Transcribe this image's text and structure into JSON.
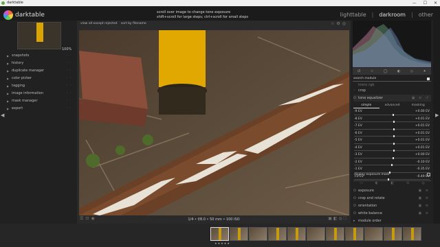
{
  "window": {
    "title": "darktable",
    "controls": [
      "—",
      "☐",
      "✕"
    ]
  },
  "app": {
    "brand": "darktable"
  },
  "hint": {
    "line1": "scroll over image to change tone exposure",
    "line2": "shift+scroll for large steps; ctrl+scroll for small steps"
  },
  "views": {
    "lighttable": "lighttable",
    "darkroom": "darkroom",
    "other": "other",
    "sep": "|"
  },
  "left_panel": {
    "zoom": "100%",
    "modules": [
      "snapshots",
      "history",
      "duplicate manager",
      "color picker",
      "tagging",
      "image information",
      "mask manager",
      "export"
    ]
  },
  "center": {
    "filter_label": "view",
    "filter_value": "all except rejected",
    "sort_label": "sort by",
    "sort_value": "filename",
    "image_info": "1/4 • f/8.0 • 50 mm • 100 ISO"
  },
  "right_panel": {
    "search_label": "search module",
    "modules_top": [
      {
        "name": "input color",
        "partial": "lnmic rgb"
      },
      {
        "name": "crop"
      },
      {
        "name": "tone equalizer"
      }
    ],
    "tone_tabs": [
      "simple",
      "advanced",
      "masking"
    ],
    "active_tab": "simple",
    "ev_rows": [
      {
        "label": "-9 EV",
        "value": "+0.00 EV",
        "pos": 0.5
      },
      {
        "label": "-8 EV",
        "value": "+0.01 EV",
        "pos": 0.51
      },
      {
        "label": "-7 EV",
        "value": "+0.01 EV",
        "pos": 0.51
      },
      {
        "label": "-6 EV",
        "value": "+0.01 EV",
        "pos": 0.51
      },
      {
        "label": "-5 EV",
        "value": "+0.01 EV",
        "pos": 0.51
      },
      {
        "label": "-4 EV",
        "value": "+0.01 EV",
        "pos": 0.51
      },
      {
        "label": "-3 EV",
        "value": "+0.00 EV",
        "pos": 0.5
      },
      {
        "label": "-2 EV",
        "value": "-0.10 EV",
        "pos": 0.49
      },
      {
        "label": "-1 EV",
        "value": "-0.35 EV",
        "pos": 0.46
      },
      {
        "label": "+0 EV",
        "value": "-0.49 EV",
        "pos": 0.44
      }
    ],
    "display_mask": "display exposure mask",
    "modules_bottom": [
      "exposure",
      "crop and rotate",
      "orientation",
      "white balance",
      "module order"
    ]
  },
  "colors": {
    "accent_yellow": "#d9a300",
    "bg": "#1e1e1e",
    "panel": "#212121"
  },
  "filmstrip": {
    "count": 12,
    "selected": 0,
    "stars": "★★★★★"
  }
}
